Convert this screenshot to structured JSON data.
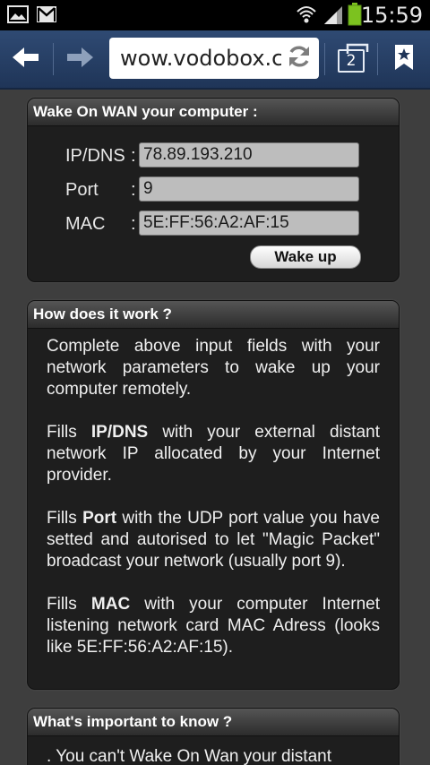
{
  "status_bar": {
    "time": "15:59",
    "icons": [
      "gallery-icon",
      "gmail-icon",
      "wifi-icon",
      "signal-icon",
      "battery-icon"
    ]
  },
  "browser": {
    "url": "wow.vodobox.com",
    "tab_count": "2",
    "icons": [
      "back-arrow-icon",
      "forward-arrow-icon",
      "refresh-icon",
      "tabs-icon",
      "bookmark-star-icon"
    ]
  },
  "wake_panel": {
    "title": "Wake On WAN your computer :",
    "fields": [
      {
        "label": "IP/DNS",
        "colon": ":",
        "value": "78.89.193.210"
      },
      {
        "label": "Port",
        "colon": ":",
        "value": "9"
      },
      {
        "label": "MAC",
        "colon": ":",
        "value": "5E:FF:56:A2:AF:15"
      }
    ],
    "wake_button": "Wake up"
  },
  "how_panel": {
    "title": "How does it work ?",
    "intro": "Complete above input fields with your network parameters to wake up your computer remotely.",
    "steps": [
      {
        "prefix": "Fills ",
        "term": "IP/DNS",
        "text": " with your external distant network IP allocated by your Internet provider."
      },
      {
        "prefix": "Fills ",
        "term": "Port",
        "text": " with the UDP port value you have setted and autorised to let \"Magic Packet\" broadcast your network (usually port 9)."
      },
      {
        "prefix": "Fills ",
        "term": "MAC",
        "text": " with your computer Internet listening network card MAC Adress (looks like 5E:FF:56:A2:AF:15)."
      }
    ]
  },
  "important_panel": {
    "title": "What's important to know ?",
    "first_line": ". You can't Wake On Wan your distant"
  },
  "colors": {
    "toolbar": "#2a4268",
    "panel_bg": "#1e1e1e",
    "page_bg": "#3e3e3e",
    "battery": "#7cc21f"
  }
}
